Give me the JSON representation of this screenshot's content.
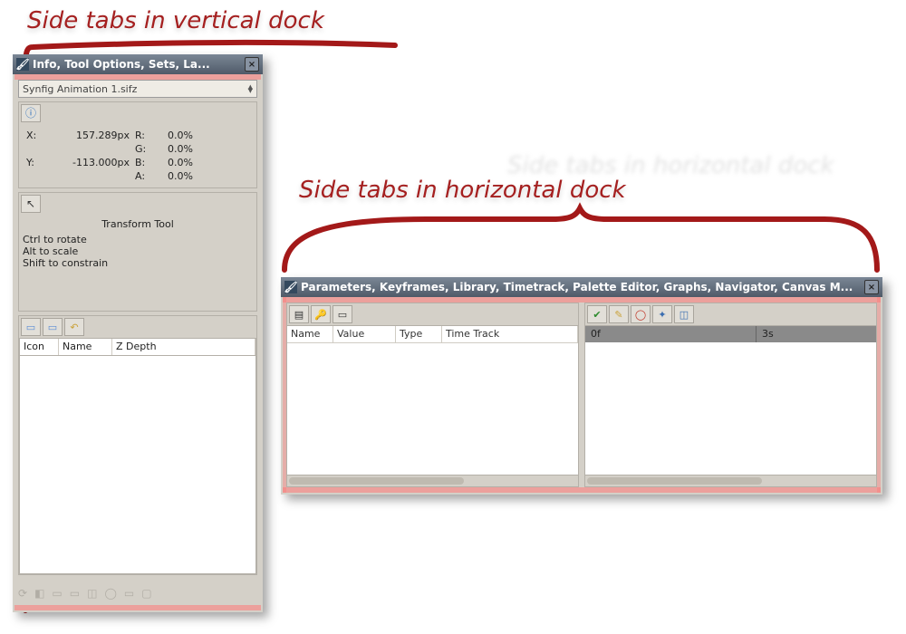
{
  "annotations": {
    "vertical": "Side tabs in vertical dock",
    "horizontal": "Side tabs in horizontal dock"
  },
  "vertical_dock": {
    "title": "Info, Tool Options, Sets, La...",
    "file_selector": "Synfig Animation 1.sifz",
    "info": {
      "x_label": "X:",
      "y_label": "Y:",
      "x_value": "157.289px",
      "y_value": "-113.000px",
      "r_label": "R:",
      "g_label": "G:",
      "b_label": "B:",
      "a_label": "A:",
      "r_value": "0.0%",
      "g_value": "0.0%",
      "b_value": "0.0%",
      "a_value": "0.0%"
    },
    "tool": {
      "title": "Transform Tool",
      "hint1": "Ctrl to rotate",
      "hint2": "Alt to scale",
      "hint3": "Shift to constrain"
    },
    "layers_table": {
      "col_icon": "Icon",
      "col_name": "Name",
      "col_zdepth": "Z Depth"
    }
  },
  "horizontal_dock": {
    "title": "Parameters, Keyframes, Library, Timetrack, Palette Editor, Graphs, Navigator, Canvas M...",
    "left_pane": {
      "col_name": "Name",
      "col_value": "Value",
      "col_type": "Type",
      "col_timetrack": "Time Track"
    },
    "right_pane": {
      "time_start": "0f",
      "time_mark": "3s"
    }
  }
}
